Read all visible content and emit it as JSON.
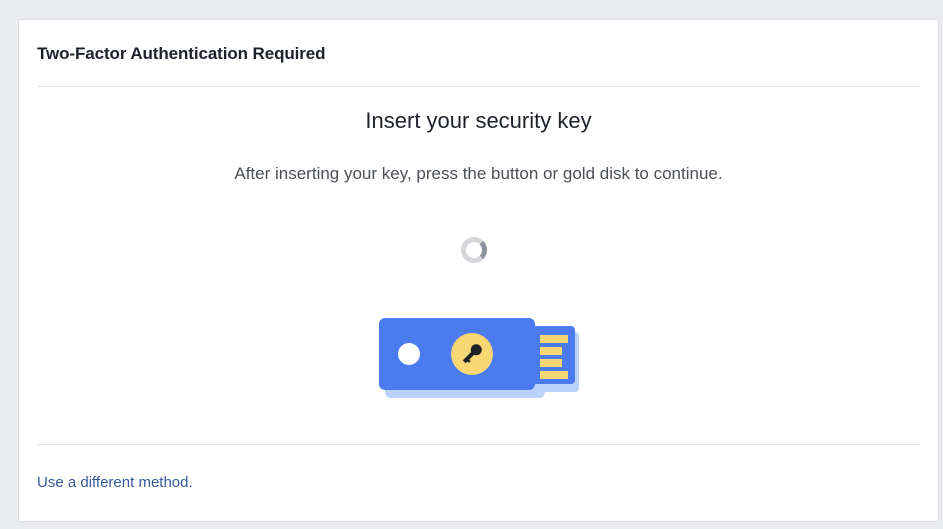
{
  "dialog": {
    "title": "Two-Factor Authentication Required",
    "heading": "Insert your security key",
    "description": "After inserting your key, press the button or gold disk to continue.",
    "alt_method_link": "Use a different method."
  },
  "icons": {
    "spinner": "loading-spinner-icon",
    "key": "usb-security-key-icon"
  },
  "colors": {
    "key_body": "#4a7cf0",
    "key_shadow": "#b9d1fb",
    "gold_disk": "#f7d774",
    "link": "#365899"
  }
}
